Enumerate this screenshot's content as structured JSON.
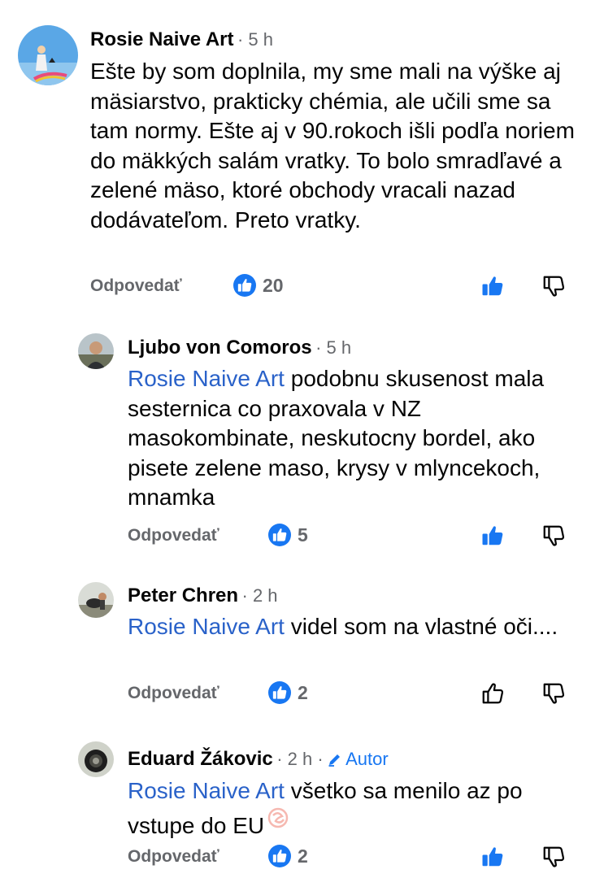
{
  "reply_label": "Odpovedať",
  "colors": {
    "accent": "#1877f2",
    "tag": "#2a62c9",
    "secondary": "#65676b"
  },
  "comments": [
    {
      "author": "Rosie Naive Art",
      "time": "· 5 h",
      "text": "Ešte by som doplnila, my sme mali na výške aj mäsiarstvo, prakticky chémia, ale učili sme sa tam normy. Ešte aj v 90.rokoch išli podľa noriem do mäkkých salám vratky. To bolo smradľavé a zelené mäso, ktoré obchody vracali nazad dodávateľom. Preto vratky.",
      "reactions": "20",
      "liked": true
    },
    {
      "author": "Ljubo von Comoros",
      "time": "· 5 h",
      "tag": "Rosie Naive Art",
      "text": " podobnu skusenost mala sesternica co praxovala v NZ masokombinate, neskutocny bordel, ako pisete zelene maso, krysy v mlyncekoch, mnamka",
      "reactions": "5",
      "liked": true
    },
    {
      "author": "Peter Chren",
      "time": "· 2 h",
      "tag": "Rosie Naive Art",
      "text": " videl som na vlastné oči....",
      "reactions": "2",
      "liked": false
    },
    {
      "author": "Eduard Žákovic",
      "time": "· 2 h ·",
      "badge": "Autor",
      "tag": "Rosie Naive Art",
      "text": " všetko sa menilo az po vstupe do EU",
      "reactions": "2",
      "liked": true
    }
  ]
}
